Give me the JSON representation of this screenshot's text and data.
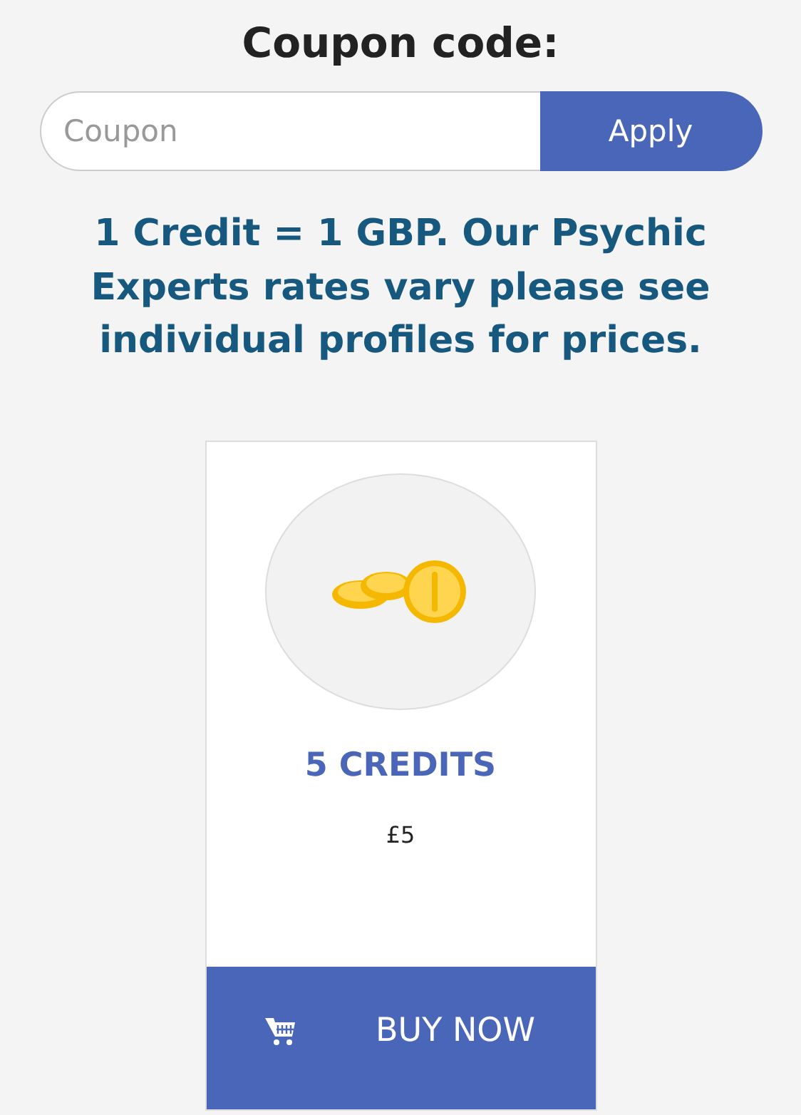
{
  "coupon": {
    "title": "Coupon code:",
    "placeholder": "Coupon",
    "button": "Apply"
  },
  "notice": "1 Credit = 1 GBP. Our Psychic Experts rates vary please see individual profiles for prices.",
  "package": {
    "name": "5 CREDITS",
    "price": "£5",
    "button": "BUY NOW"
  }
}
